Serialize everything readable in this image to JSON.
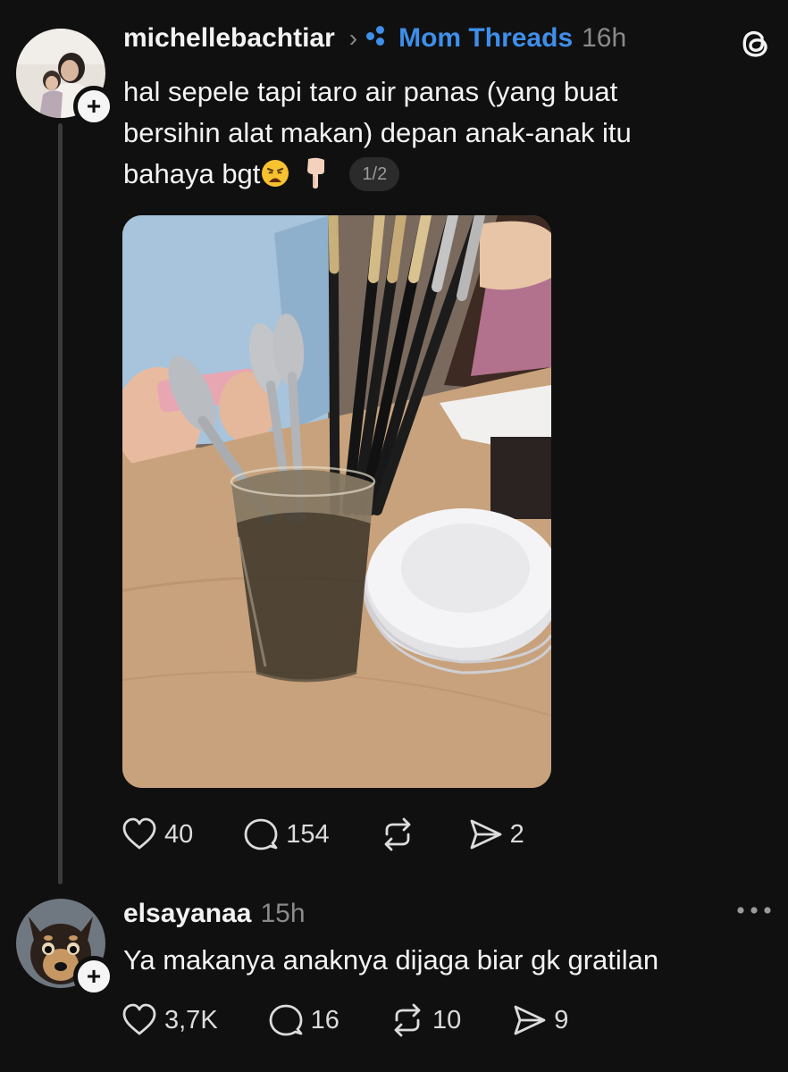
{
  "posts": [
    {
      "username": "michellebachtiar",
      "community": "Mom Threads",
      "time": "16h",
      "text_lines": [
        "hal sepele tapi taro air panas (yang buat",
        "bersihin alat makan) depan anak-anak itu",
        "bahaya bgt"
      ],
      "emojis": [
        "weary-face",
        "pointing-down-hand"
      ],
      "page_indicator": "1/2",
      "media": "photo of a glass of dark water holding spoons and chopsticks beside stacked white plates on a wooden table",
      "actions": {
        "likes": "40",
        "replies": "154",
        "reposts": "",
        "shares": "2"
      }
    },
    {
      "username": "elsayanaa",
      "time": "15h",
      "text": "Ya makanya anaknya dijaga biar gk gratilan",
      "actions": {
        "likes": "3,7K",
        "replies": "16",
        "reposts": "10",
        "shares": "9"
      }
    }
  ],
  "icons": {
    "follow": "plus-icon",
    "like": "heart-icon",
    "reply": "speech-bubble-icon",
    "repost": "repost-icon",
    "share": "send-icon",
    "app": "threads-logo-icon",
    "more": "more-icon"
  },
  "colors": {
    "background": "#101010",
    "text": "#f3f3f3",
    "muted": "#8a8a8a",
    "community": "#3e8fea",
    "thread_line": "#3a3a3a"
  }
}
